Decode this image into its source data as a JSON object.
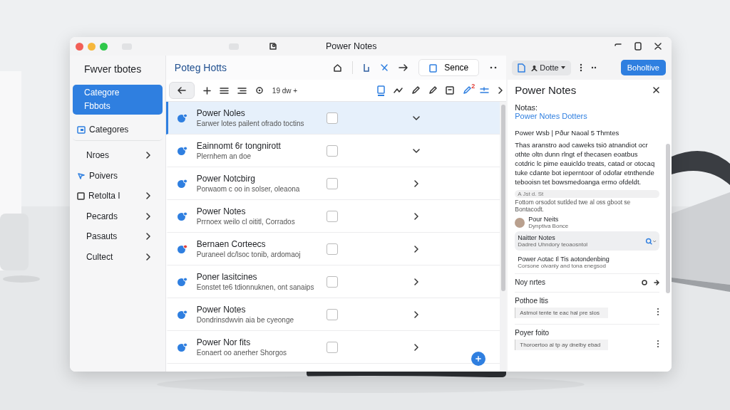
{
  "window": {
    "title": "Power Notes"
  },
  "sidebar": {
    "app_title": "Fwver tbotes",
    "items": [
      {
        "label": "Categore Fbbots",
        "selected": true,
        "kind": "plain"
      },
      {
        "label": "Categores",
        "selected": false,
        "kind": "plain"
      },
      {
        "label": "Nroes",
        "selected": false,
        "kind": "group"
      },
      {
        "label": "Poivers",
        "selected": false,
        "kind": "plain"
      },
      {
        "label": "Retolta I",
        "selected": false,
        "kind": "group"
      },
      {
        "label": "Pecards",
        "selected": false,
        "kind": "group"
      },
      {
        "label": "Pasauts",
        "selected": false,
        "kind": "group"
      },
      {
        "label": "Cultect",
        "selected": false,
        "kind": "group"
      }
    ]
  },
  "main": {
    "title": "Poteg Hotts",
    "save_button": "Sence",
    "toolbar_text": "19 dw +",
    "edit_badge": "2",
    "notes": [
      {
        "title": "Power Noles",
        "subtitle": "Earwer lotes pailent ofrado toctins",
        "selected": true,
        "checked": false,
        "expanded": true,
        "flagged": false
      },
      {
        "title": "Eainnomt 6r tongnirott",
        "subtitle": "Plernhem an doe",
        "selected": false,
        "checked": false,
        "expanded": true,
        "flagged": false
      },
      {
        "title": "Power Notcbirg",
        "subtitle": "Porwaom c oo in solser, oleaona",
        "selected": false,
        "checked": false,
        "expanded": false,
        "flagged": false
      },
      {
        "title": "Power Notes",
        "subtitle": "Prrnoex weilo cl oititl, Corrados",
        "selected": false,
        "checked": false,
        "expanded": false,
        "flagged": false
      },
      {
        "title": "Bernaen Corteecs",
        "subtitle": "Puraneel dc/lsoc tonib, ardomaoj",
        "selected": false,
        "checked": false,
        "expanded": false,
        "flagged": true
      },
      {
        "title": "Poner lasitcines",
        "subtitle": "Eonstet te6 tdionnuknen, ont sanaips",
        "selected": false,
        "checked": false,
        "expanded": false,
        "flagged": false
      },
      {
        "title": "Power Notes",
        "subtitle": "Dondrinsdwvin aia be cyeonge",
        "selected": false,
        "checked": false,
        "expanded": false,
        "flagged": false
      },
      {
        "title": "Power Nor fits",
        "subtitle": "Eonaert oo anerher Shorgos",
        "selected": false,
        "checked": false,
        "expanded": false,
        "flagged": false
      }
    ]
  },
  "panel": {
    "dropdown": "Dotte",
    "action_button": "Boholtive",
    "title": "Power Notes",
    "label": "Notas:",
    "link": "Power Notes Dotters",
    "meta": "Power Wsb | Pður Naoal 5 Thmtes",
    "body": "Thas aranstro aod caweks tsiö atnandiot ocr othte oltn dunn rlngt ef thecasen eoatbus cotdric lc pime eauicldo treats, catad or otocaq tuke cdante bot ieperntoor of odofar etnthende tebooisn tet bowsmedoanga ermo ofdeldt.",
    "quote_head": "A Jst d. St",
    "quote": "Fottom orsodot sutlded twe al oss gboot se Bontacodt.",
    "author": {
      "name": "Pour Neits",
      "role": "Dynptiva Bonce"
    },
    "entries": [
      {
        "title": "Naitter Notes",
        "subtitle": "Dadred Uhndory teoaosntol",
        "selected": true
      },
      {
        "title": "Power Aotac Il Tis aotondenbing",
        "subtitle": "Corsone olvanly and tona enegsod",
        "selected": false
      }
    ],
    "sections": [
      {
        "kind": "link",
        "title": "Noy nrtes"
      },
      {
        "kind": "comment",
        "title": "Pothoe ltis",
        "comment": "Astmol tente te eac hal pre slos"
      },
      {
        "kind": "comment",
        "title": "Poyer foito",
        "comment": "Thoroertoo al tp ay dnelby ebad"
      }
    ]
  }
}
